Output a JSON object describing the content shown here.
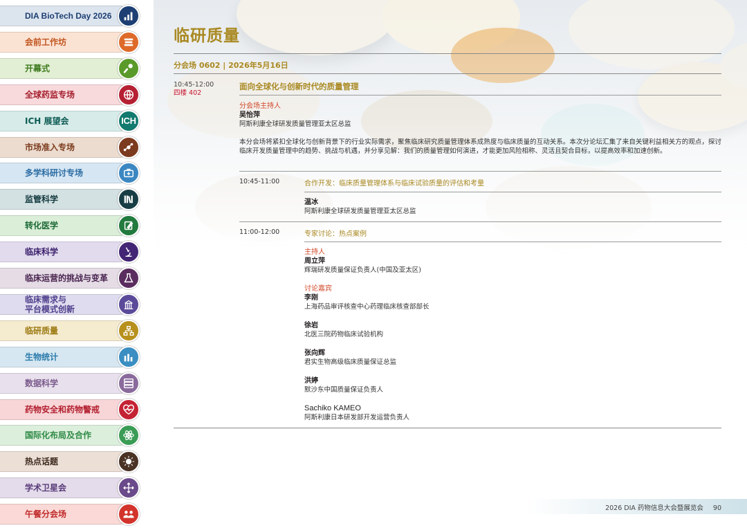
{
  "sidebar": {
    "items": [
      {
        "label": "DIA BioTech Day 2026",
        "bg": "#dce4ee",
        "text_color": "#1d3f73",
        "icon_color": "#1d3f73",
        "icon": "bar-chart-icon"
      },
      {
        "label": "会前工作坊",
        "bg": "#fbe3d4",
        "text_color": "#c2551f",
        "icon_color": "#de6a2a",
        "icon": "books-icon"
      },
      {
        "label": "开幕式",
        "bg": "#e2efd4",
        "text_color": "#3f7a1f",
        "icon_color": "#5a9a2a",
        "icon": "microphone-icon"
      },
      {
        "label": "全球药监专场",
        "bg": "#f8d9dc",
        "text_color": "#a51f2c",
        "icon_color": "#b52033",
        "icon": "globe-icon"
      },
      {
        "label": "ICH 展望会",
        "bg": "#d7ece9",
        "text_color": "#0f5c55",
        "icon_color": "#137a6f",
        "icon": "ich-icon",
        "icon_text": "ICH"
      },
      {
        "label": "市场准入专场",
        "bg": "#ecdcd0",
        "text_color": "#7a3a1c",
        "icon_color": "#7c3a1e",
        "icon": "network-icon"
      },
      {
        "label": "多学科研讨专场",
        "bg": "#d6e6f3",
        "text_color": "#2b6ca3",
        "icon_color": "#3b87c2",
        "icon": "medkit-icon"
      },
      {
        "label": "监管科学",
        "bg": "#d3e1e3",
        "text_color": "#13393d",
        "icon_color": "#173e44",
        "icon": "bookshelf-icon"
      },
      {
        "label": "转化医学",
        "bg": "#dbeed8",
        "text_color": "#1d6a36",
        "icon_color": "#237a3e",
        "icon": "pencil-note-icon"
      },
      {
        "label": "临床科学",
        "bg": "#e2dbee",
        "text_color": "#3a1f6b",
        "icon_color": "#432575",
        "icon": "microscope-icon"
      },
      {
        "label": "临床运营的挑战与变革",
        "bg": "#e5dce6",
        "text_color": "#4a2550",
        "icon_color": "#5a2d5f",
        "icon": "flask-icon"
      },
      {
        "label": "临床需求与平台模式创新",
        "label_line1": "临床需求与",
        "label_line2": "平台模式创新",
        "bg": "#dfdcef",
        "text_color": "#4f3f8c",
        "icon_color": "#5b4a99",
        "icon": "building-icon"
      },
      {
        "label": "临研质量",
        "bg": "#f5ebcf",
        "text_color": "#9c7a12",
        "icon_color": "#b8901d",
        "icon": "hierarchy-icon"
      },
      {
        "label": "生物统计",
        "bg": "#d6e7f1",
        "text_color": "#2a7bab",
        "icon_color": "#3a8ec2",
        "icon": "column-chart-icon"
      },
      {
        "label": "数据科学",
        "bg": "#e8e0ec",
        "text_color": "#7a5a8c",
        "icon_color": "#8a6a9c",
        "icon": "database-icon"
      },
      {
        "label": "药物安全和药物警戒",
        "bg": "#f8d6d8",
        "text_color": "#b21f2e",
        "icon_color": "#c42334",
        "icon": "heartbeat-icon"
      },
      {
        "label": "国际化布局及合作",
        "bg": "#dcefdc",
        "text_color": "#2e8a46",
        "icon_color": "#3a9c55",
        "icon": "atom-icon"
      },
      {
        "label": "热点话题",
        "bg": "#ecdfd6",
        "text_color": "#3e2a1e",
        "icon_color": "#4a3225",
        "icon": "sun-icon"
      },
      {
        "label": "学术卫星会",
        "bg": "#e4dbeb",
        "text_color": "#5a3d7a",
        "icon_color": "#6a4a8a",
        "icon": "move-arrows-icon"
      },
      {
        "label": "午餐分会场",
        "bg": "#fad9d6",
        "text_color": "#c02a2a",
        "icon_color": "#d2342c",
        "icon": "people-discussion-icon"
      }
    ]
  },
  "page": {
    "title": "临研质量",
    "session_header": "分会场 0602 | 2026年5月16日",
    "time_range": "10:45-12:00",
    "room": "四楼 402",
    "session_title": "面向全球化与创新时代的质量管理",
    "chair_role": "分会场主持人",
    "chair_name": "吴怡萍",
    "chair_affiliation": "阿斯利康全球研发质量管理亚太区总监",
    "description": "本分会场将紧扣全球化与创新背景下的行业实际需求，聚焦临床研究质量管理体系成熟度与临床质量的互动关系。本次分论坛汇集了来自关键利益相关方的观点，探讨临床开发质量管理中的趋势、挑战与机遇，并分享见解：我们的质量管理如何演进，才能更加风险相称、灵活且契合目标，以提高效率和加速创新。",
    "talks": [
      {
        "time": "10:45-11:00",
        "title": "合作开发：临床质量管理体系与临床试验质量的评估和考量",
        "speaker": "温冰",
        "affiliation": "阿斯利康全球研发质量管理亚太区总监"
      },
      {
        "time": "11:00-12:00",
        "title": "专家讨论：热点案例",
        "moderator_role": "主持人",
        "moderator_name": "周立萍",
        "moderator_affiliation": "辉瑞研发质量保证负责人(中国及亚太区)",
        "panel_role": "讨论嘉宾",
        "panelists": [
          {
            "name": "李刚",
            "affiliation": "上海药品审评核查中心药理临床核查部部长"
          },
          {
            "name": "徐岩",
            "affiliation": "北医三院药物临床试验机构"
          },
          {
            "name": "张向辉",
            "affiliation": "君实生物高级临床质量保证总监"
          },
          {
            "name": "洪婷",
            "affiliation": "默沙东中国质量保证负责人"
          },
          {
            "name": "Sachiko KAMEO",
            "affiliation": "阿斯利康日本研发部开发运营负责人"
          }
        ]
      }
    ]
  },
  "footer": {
    "text": "2026 DIA 药物信息大会暨展览会",
    "page_number": "90"
  },
  "colors": {
    "accent_gold": "#a98922",
    "role_orange": "#d2492a",
    "room_red": "#c8102e"
  }
}
